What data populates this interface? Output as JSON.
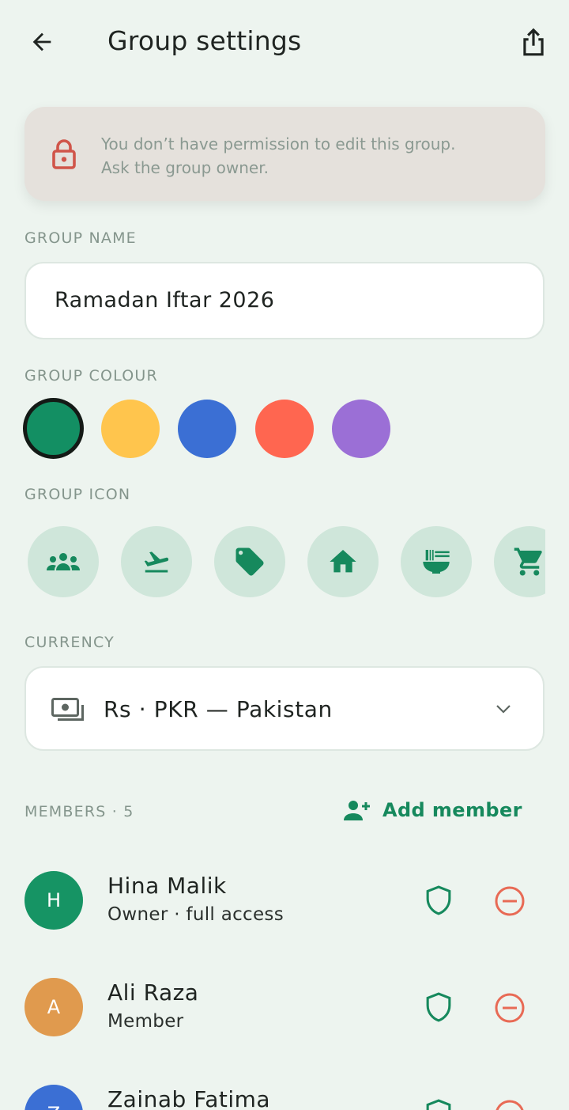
{
  "header": {
    "title": "Group settings",
    "back_icon": "arrow-left-icon",
    "share_icon": "share-icon"
  },
  "banner": {
    "line1": "You don’t have permission to edit this group.",
    "line2": "Ask the group owner.",
    "icon": "lock-icon"
  },
  "group_name": {
    "label": "GROUP NAME",
    "value": "Ramadan Iftar 2026"
  },
  "group_colour": {
    "label": "GROUP COLOUR",
    "swatches": [
      "#138f63",
      "#ffc54d",
      "#3b6fd4",
      "#ff6650",
      "#9b6fd6"
    ],
    "selected": "#138f63"
  },
  "group_icon": {
    "label": "GROUP ICON",
    "icons": [
      "group-icon",
      "flight-takeoff-icon",
      "tag-icon",
      "home-icon",
      "ramen-bowl-icon",
      "shopping-cart-icon"
    ]
  },
  "currency": {
    "label": "CURRENCY",
    "value": "Rs · PKR — Pakistan",
    "icon": "money-icon"
  },
  "members": {
    "label": "MEMBERS · 5",
    "add_label": "Add member",
    "list": [
      {
        "initial": "H",
        "name": "Hina Malik",
        "role": "Owner · full access",
        "color": "#169464"
      },
      {
        "initial": "A",
        "name": "Ali Raza",
        "role": "Member",
        "color": "#e09a4e"
      },
      {
        "initial": "Z",
        "name": "Zainab Fatima",
        "role": "",
        "color": "#3b6fd4"
      }
    ]
  },
  "colors": {
    "accent": "#16895d",
    "danger": "#e86a55",
    "background": "#edf4ef"
  }
}
